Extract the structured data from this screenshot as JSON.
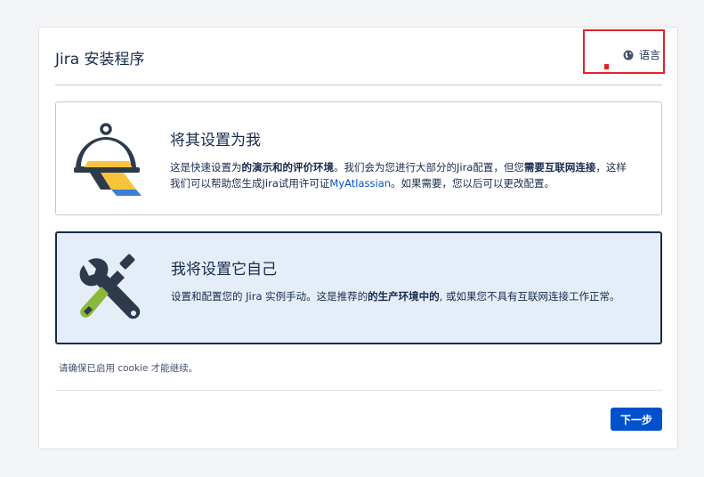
{
  "header": {
    "title": "Jira 安装程序",
    "language_label": "语言",
    "language_icon": "globe-icon"
  },
  "options": [
    {
      "icon": "service-bell-icon",
      "heading": "将其设置为我",
      "desc_parts": [
        "这是快速设置为",
        "的演示和",
        "的评价环境",
        "。我们会为您进行大部分的Jira配置，但您",
        "需要互联网连接",
        "，这样我们可以帮助您生成Jira试用许可证",
        "MyAtlassian",
        "。如果需要，您以后可以更改配置。"
      ],
      "selected": false
    },
    {
      "icon": "tools-icon",
      "heading": "我将设置它自己",
      "desc_parts": [
        "设置和配置您的 Jira 实例手动。这是推荐的",
        "的生产环境中的",
        ", 或如果您不具有互联网连接工作正常。"
      ],
      "selected": true
    }
  ],
  "cookie_note": "请确保已启用 cookie 才能继续。",
  "footer": {
    "next_label": "下一步"
  },
  "colors": {
    "accent": "#0052cc",
    "highlight": "#e0242a",
    "selected_bg": "#e5edf8"
  }
}
